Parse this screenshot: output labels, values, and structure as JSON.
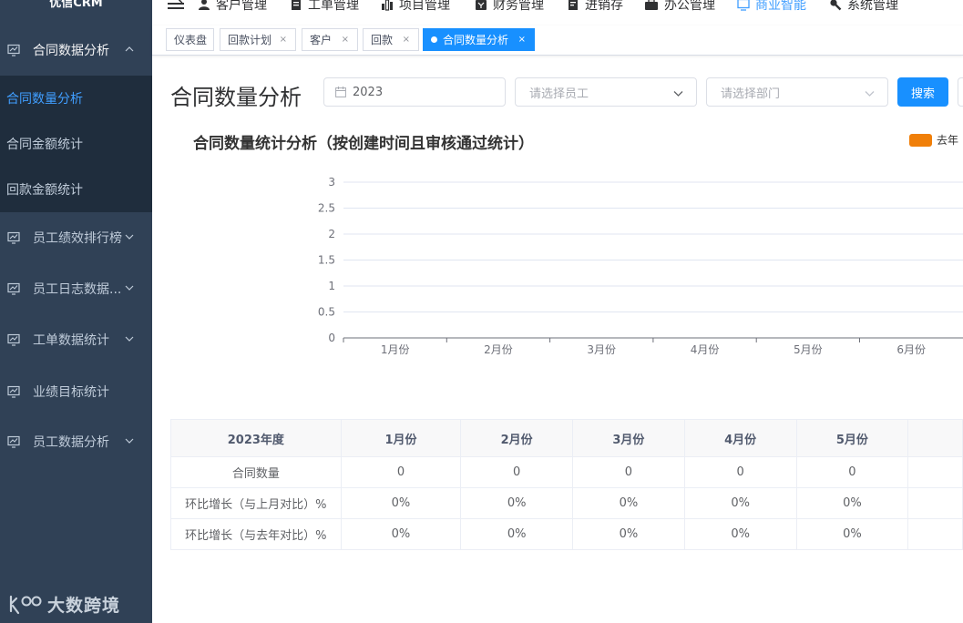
{
  "app": {
    "logo_text": "优信CRM"
  },
  "top_nav": [
    {
      "label": "客户管理",
      "icon": "user-icon"
    },
    {
      "label": "工单管理",
      "icon": "document-icon"
    },
    {
      "label": "项目管理",
      "icon": "chart-bars-icon"
    },
    {
      "label": "财务管理",
      "icon": "finance-icon"
    },
    {
      "label": "进销存",
      "icon": "inventory-icon"
    },
    {
      "label": "办公管理",
      "icon": "briefcase-icon"
    },
    {
      "label": "商业智能",
      "icon": "monitor-icon",
      "active": true
    },
    {
      "label": "系统管理",
      "icon": "wrench-icon"
    }
  ],
  "tags": [
    {
      "label": "仪表盘",
      "closable": false
    },
    {
      "label": "回款计划",
      "closable": true
    },
    {
      "label": "客户",
      "closable": true
    },
    {
      "label": "回款",
      "closable": true
    },
    {
      "label": "合同数量分析",
      "closable": true,
      "active": true
    }
  ],
  "sidebar": {
    "expanded_group": "合同数据分析",
    "sub_items": [
      {
        "label": "合同数量分析",
        "active": true
      },
      {
        "label": "合同金额统计"
      },
      {
        "label": "回款金额统计"
      }
    ],
    "groups": [
      {
        "label": "员工绩效排行榜",
        "has_children": true
      },
      {
        "label": "员工日志数据...",
        "has_children": true
      },
      {
        "label": "工单数据统计",
        "has_children": true
      },
      {
        "label": "业绩目标统计",
        "has_children": false
      },
      {
        "label": "员工数据分析",
        "has_children": true
      }
    ],
    "watermark": "大数跨境"
  },
  "page": {
    "title": "合同数量分析",
    "year_value": "2023",
    "employee_placeholder": "请选择员工",
    "department_placeholder": "请选择部门",
    "search_label": "搜索"
  },
  "chart_data": {
    "type": "bar",
    "title": "合同数量统计分析（按创建时间且审核通过统计）",
    "categories": [
      "1月份",
      "2月份",
      "3月份",
      "4月份",
      "5月份",
      "6月份"
    ],
    "series": [
      {
        "name": "去年",
        "values": [
          0,
          0,
          0,
          0,
          0,
          0
        ],
        "color": "#f07f09"
      }
    ],
    "yticks": [
      "0",
      "0.5",
      "1",
      "1.5",
      "2",
      "2.5",
      "3"
    ],
    "ylim": [
      0,
      3
    ],
    "grid": true,
    "legend": "top-right"
  },
  "table": {
    "header": [
      "2023年度",
      "1月份",
      "2月份",
      "3月份",
      "4月份",
      "5月份"
    ],
    "rows": [
      [
        "合同数量",
        "0",
        "0",
        "0",
        "0",
        "0"
      ],
      [
        "环比增长（与上月对比）%",
        "0%",
        "0%",
        "0%",
        "0%",
        "0%"
      ],
      [
        "环比增长（与去年对比）%",
        "0%",
        "0%",
        "0%",
        "0%",
        "0%"
      ]
    ]
  },
  "colors": {
    "sidebar_bg": "#304156",
    "submenu_bg": "#1f2d3d",
    "accent": "#1890ff",
    "series": "#f07f09"
  }
}
